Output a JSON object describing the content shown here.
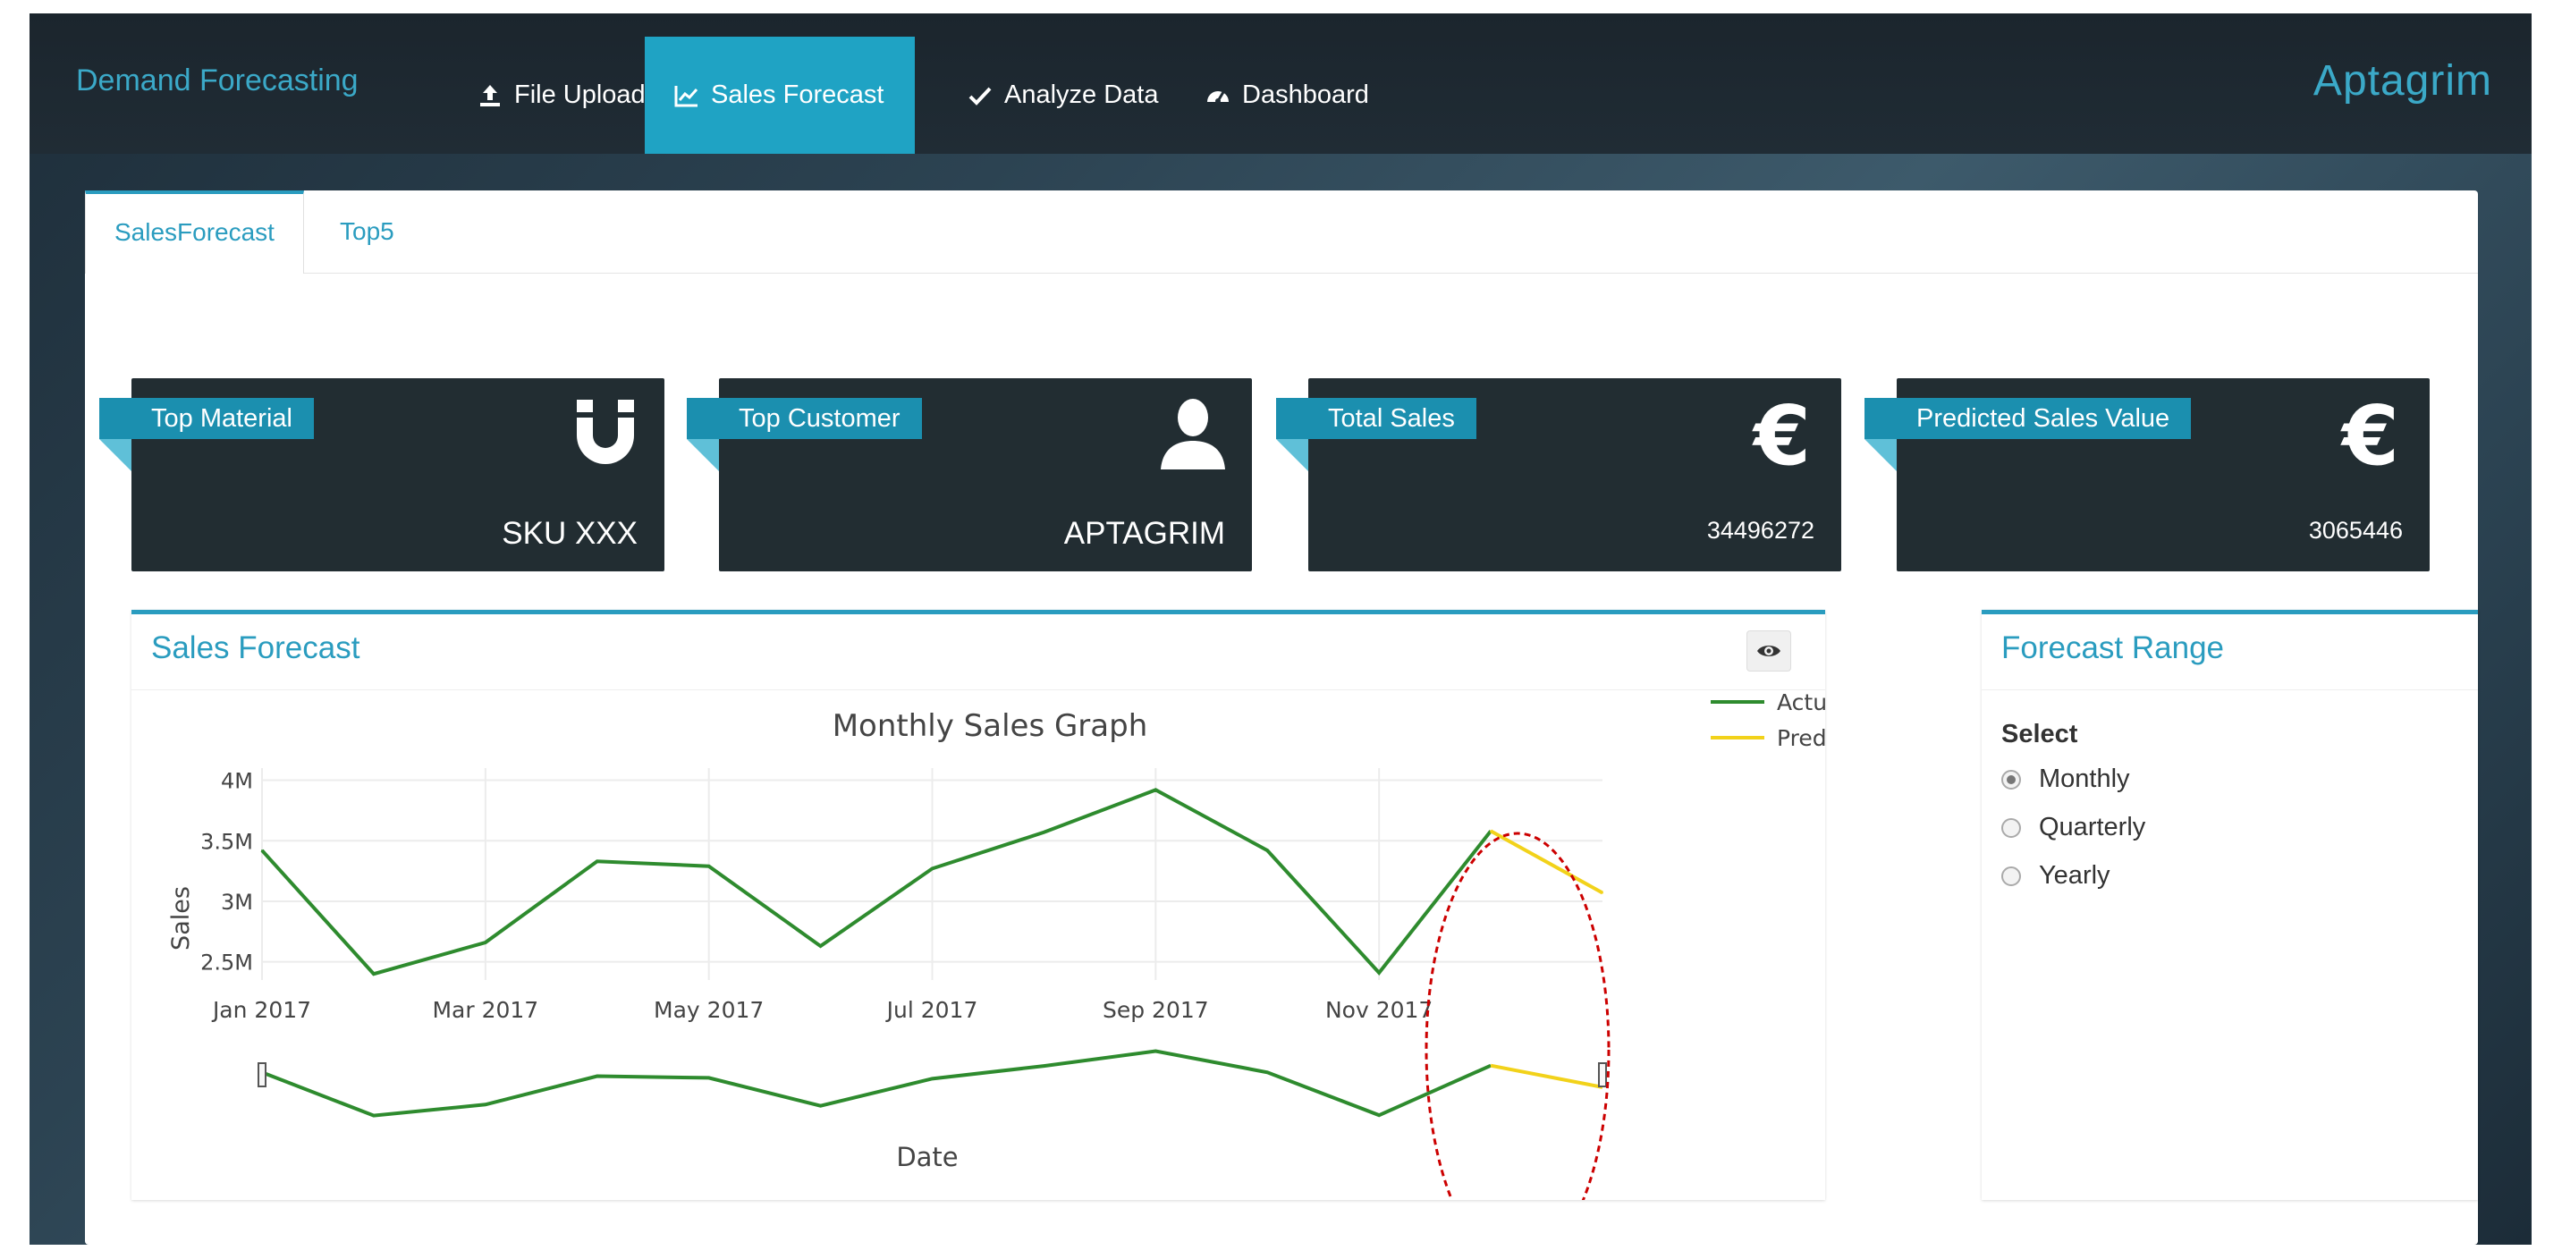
{
  "navbar": {
    "brand": "Demand Forecasting",
    "items": [
      {
        "label": "File Upload",
        "icon": "upload-icon",
        "active": false
      },
      {
        "label": "Sales Forecast",
        "icon": "line-chart-icon",
        "active": true
      },
      {
        "label": "Analyze Data",
        "icon": "check-icon",
        "active": false
      },
      {
        "label": "Dashboard",
        "icon": "dashboard-icon",
        "active": false
      }
    ],
    "logo": "Aptagrim"
  },
  "tabs": [
    {
      "label": "SalesForecast",
      "active": true
    },
    {
      "label": "Top5",
      "active": false
    }
  ],
  "cards": [
    {
      "title": "Top Material",
      "icon": "magnet-icon",
      "value": "SKU XXX"
    },
    {
      "title": "Top Customer",
      "icon": "user-icon",
      "value": "APTAGRIM"
    },
    {
      "title": "Total Sales",
      "icon": "euro-icon",
      "value": "34496272"
    },
    {
      "title": "Predicted Sales Value",
      "icon": "euro-icon",
      "value": "3065446"
    }
  ],
  "sales_box": {
    "title": "Sales Forecast"
  },
  "range_box": {
    "title": "Forecast Range",
    "select_label": "Select",
    "options": [
      {
        "label": "Monthly",
        "checked": true
      },
      {
        "label": "Quarterly",
        "checked": false
      },
      {
        "label": "Yearly",
        "checked": false
      }
    ]
  },
  "colors": {
    "accent": "#2a9cbf",
    "actual": "#2e8b2e",
    "prediction": "#f2d21a",
    "annotation": "#cc0000"
  },
  "chart_data": {
    "type": "line",
    "title": "Monthly Sales Graph",
    "xlabel": "Date",
    "ylabel": "Sales",
    "x_ticks": [
      "Jan 2017",
      "Mar 2017",
      "May 2017",
      "Jul 2017",
      "Sep 2017",
      "Nov 2017"
    ],
    "y_ticks": [
      "2.5M",
      "3M",
      "3.5M",
      "4M"
    ],
    "ylim": [
      2350000,
      4100000
    ],
    "x": [
      "2017-01",
      "2017-02",
      "2017-03",
      "2017-04",
      "2017-05",
      "2017-06",
      "2017-07",
      "2017-08",
      "2017-09",
      "2017-10",
      "2017-11",
      "2017-12",
      "2018-01"
    ],
    "series": [
      {
        "name": "Actual",
        "values": [
          3420000,
          2400000,
          2660000,
          3330000,
          3290000,
          2630000,
          3270000,
          3570000,
          3920000,
          3420000,
          2410000,
          3580000,
          null
        ]
      },
      {
        "name": "Prediction",
        "values": [
          null,
          null,
          null,
          null,
          null,
          null,
          null,
          null,
          null,
          null,
          null,
          3580000,
          3070000
        ]
      }
    ],
    "legend": "top-right",
    "grid": true,
    "range_slider": true,
    "annotation": "dashed red ellipse around prediction segment"
  }
}
